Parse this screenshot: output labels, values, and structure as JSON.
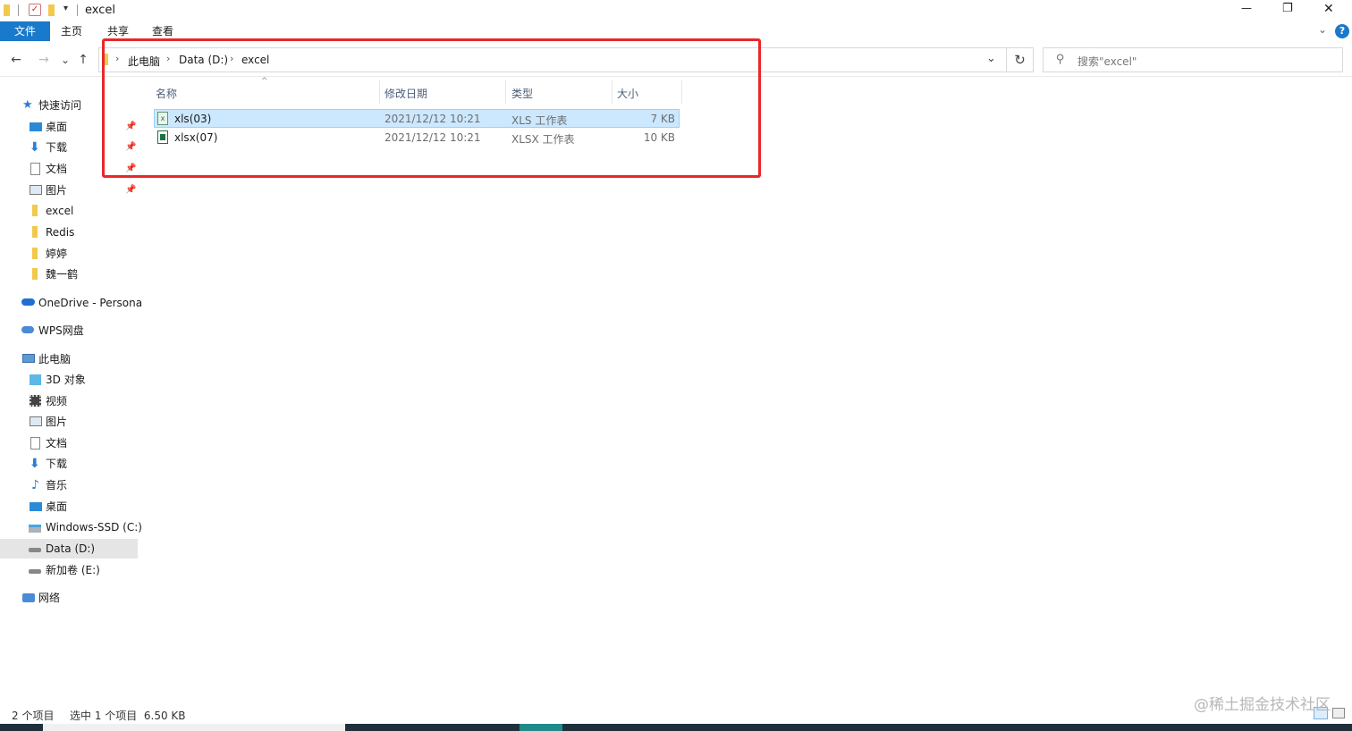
{
  "window": {
    "title": "excel",
    "controls": {
      "minimize": "—",
      "restore": "❐",
      "close": "✕"
    }
  },
  "ribbon": {
    "tabs": [
      "文件",
      "主页",
      "共享",
      "查看"
    ],
    "help_label": "?"
  },
  "navigation": {
    "back": "←",
    "forward": "→",
    "recent": "⌄",
    "up": "↑",
    "breadcrumb": [
      "此电脑",
      "Data (D:)",
      "excel"
    ],
    "refresh": "↻",
    "search_placeholder": "搜索\"excel\""
  },
  "sidebar": {
    "quick_access": {
      "label": "快速访问",
      "items": [
        {
          "label": "桌面",
          "icon": "desktop-icon",
          "pinned": true
        },
        {
          "label": "下载",
          "icon": "download-icon",
          "pinned": true
        },
        {
          "label": "文档",
          "icon": "document-icon",
          "pinned": true
        },
        {
          "label": "图片",
          "icon": "picture-icon",
          "pinned": true
        },
        {
          "label": "excel",
          "icon": "folder-icon",
          "pinned": false
        },
        {
          "label": "Redis",
          "icon": "folder-icon",
          "pinned": false
        },
        {
          "label": "婷婷",
          "icon": "folder-icon",
          "pinned": false
        },
        {
          "label": "魏一鹤",
          "icon": "folder-icon",
          "pinned": false
        }
      ]
    },
    "onedrive": "OneDrive - Persona",
    "wps": "WPS网盘",
    "this_pc": {
      "label": "此电脑",
      "items": [
        {
          "label": "3D 对象",
          "icon": "cube-icon"
        },
        {
          "label": "视频",
          "icon": "video-icon"
        },
        {
          "label": "图片",
          "icon": "picture-icon"
        },
        {
          "label": "文档",
          "icon": "document-icon"
        },
        {
          "label": "下载",
          "icon": "download-icon"
        },
        {
          "label": "音乐",
          "icon": "music-icon"
        },
        {
          "label": "桌面",
          "icon": "desktop-icon"
        },
        {
          "label": "Windows-SSD (C:)",
          "icon": "windows-drive-icon"
        },
        {
          "label": "Data (D:)",
          "icon": "drive-icon",
          "selected": true
        },
        {
          "label": "新加卷 (E:)",
          "icon": "drive-icon"
        }
      ]
    },
    "network": "网络"
  },
  "file_list": {
    "columns": [
      "名称",
      "修改日期",
      "类型",
      "大小"
    ],
    "rows": [
      {
        "name": "xls(03)",
        "modified": "2021/12/12 10:21",
        "type": "XLS 工作表",
        "size": "7 KB",
        "selected": true
      },
      {
        "name": "xlsx(07)",
        "modified": "2021/12/12 10:21",
        "type": "XLSX 工作表",
        "size": "10 KB",
        "selected": false
      }
    ]
  },
  "status": {
    "item_count": "2 个项目",
    "selection": "选中 1 个项目  6.50 KB"
  },
  "watermark": "@稀土掘金技术社区",
  "colors": {
    "accent": "#1979ca",
    "selection": "#cce8ff",
    "highlight_box": "#e8282a",
    "excel_green": "#1e7145"
  }
}
